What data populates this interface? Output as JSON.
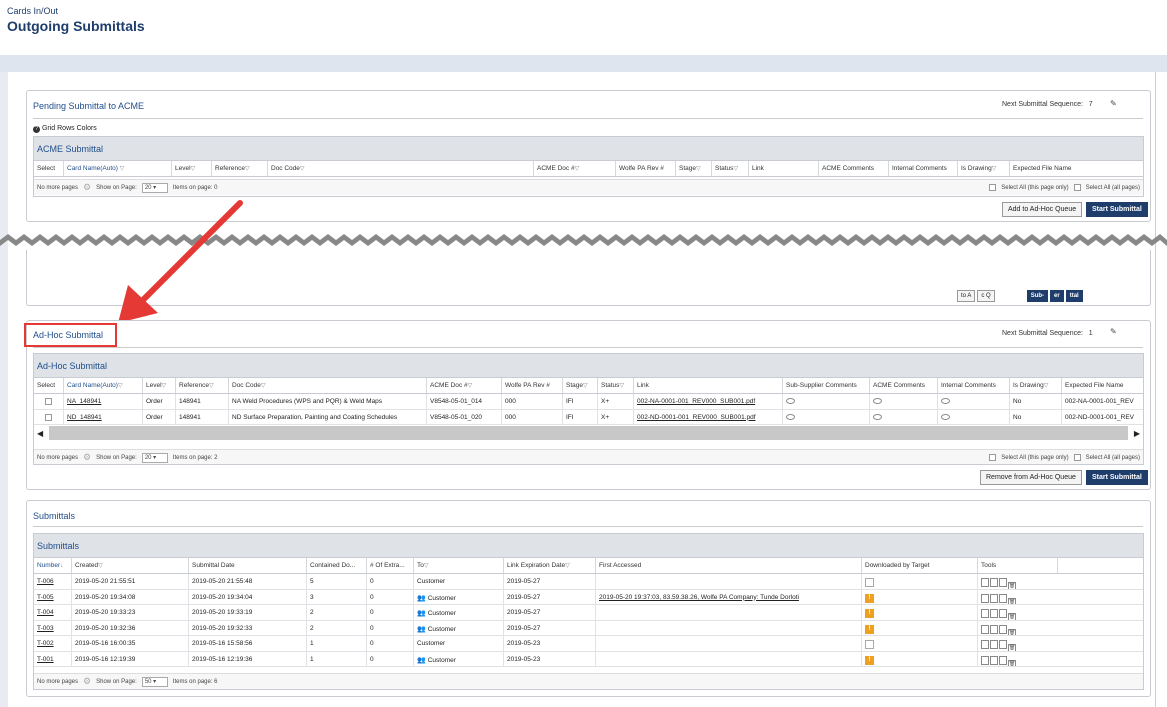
{
  "header": {
    "breadcrumb": "Cards In/Out",
    "title": "Outgoing Submittals"
  },
  "pending": {
    "title": "Pending Submittal to ACME",
    "next_seq_label": "Next Submittal Sequence:",
    "next_seq_value": "7",
    "grid_colors": "Grid Rows Colors",
    "grid_title": "ACME Submittal",
    "columns": [
      "Select",
      "Card Name(Auto)",
      "Level",
      "Reference",
      "Doc Code",
      "ACME Doc #",
      "Wolfe PA Rev #",
      "Stage",
      "Status",
      "Link",
      "ACME Comments",
      "Internal Comments",
      "Is Drawing",
      "Expected File Name"
    ],
    "pager": {
      "no_more": "No more pages",
      "show_on_page": "Show on Page:",
      "page_size": "20",
      "items_label": "Items on page: 0",
      "select_all_page": "Select All (this page only)",
      "select_all_pages": "Select All (all pages)"
    },
    "btn_add": "Add to Ad-Hoc Queue",
    "btn_start": "Start Submittal"
  },
  "partial_buttons": {
    "a": "to A",
    "b": "c Q",
    "c": "Sub-",
    "d": "er",
    "e": "ttal"
  },
  "adhoc": {
    "title": "Ad-Hoc Submittal",
    "next_seq_label": "Next Submittal Sequence:",
    "next_seq_value": "1",
    "grid_title": "Ad-Hoc Submittal",
    "columns": [
      "Select",
      "Card Name(Auto)",
      "Level",
      "Reference",
      "Doc Code",
      "ACME Doc #",
      "Wolfe PA Rev #",
      "Stage",
      "Status",
      "Link",
      "Sub-Supplier Comments",
      "ACME Comments",
      "Internal Comments",
      "Is Drawing",
      "Expected File Name"
    ],
    "rows": [
      {
        "card": "NA_148941",
        "level": "Order",
        "ref": "148941",
        "doc_code": "NA Weld Procedures (WPS and PQR) & Weld Maps",
        "acme_doc": "V8548-05-01_014",
        "rev": "000",
        "stage": "IFI",
        "status": "X+",
        "link": "002-NA-0001-001_REV000_SUB001.pdf",
        "is_drawing": "No",
        "expected": "002-NA-0001-001_REV"
      },
      {
        "card": "ND_148941",
        "level": "Order",
        "ref": "148941",
        "doc_code": "ND Surface Preparation, Painting and Coating Schedules",
        "acme_doc": "V8548-05-01_020",
        "rev": "000",
        "stage": "IFI",
        "status": "X+",
        "link": "002-ND-0001-001_REV000_SUB001.pdf",
        "is_drawing": "No",
        "expected": "002-ND-0001-001_REV"
      }
    ],
    "pager": {
      "no_more": "No more pages",
      "show_on_page": "Show on Page:",
      "page_size": "20",
      "items_label": "Items on page: 2",
      "select_all_page": "Select All (this page only)",
      "select_all_pages": "Select All (all pages)"
    },
    "btn_remove": "Remove from Ad-Hoc Queue",
    "btn_start": "Start Submittal"
  },
  "submittals": {
    "title": "Submittals",
    "grid_title": "Submittals",
    "columns": [
      "Number",
      "Created",
      "Submittal Date",
      "Contained Do...",
      "# Of Extra...",
      "To",
      "Link Expiration Date",
      "First Accessed",
      "Downloaded by Target",
      "Tools"
    ],
    "rows": [
      {
        "num": "T-006",
        "created": "2019-05-20 21:55:51",
        "date": "2019-05-20 21:55:48",
        "contained": "5",
        "extra": "0",
        "to": "Customer",
        "group": false,
        "expires": "2019-05-27",
        "accessed": "",
        "downloaded": false
      },
      {
        "num": "T-005",
        "created": "2019-05-20 19:34:08",
        "date": "2019-05-20 19:34:04",
        "contained": "3",
        "extra": "0",
        "to": "Customer",
        "group": true,
        "expires": "2019-05-27",
        "accessed": "2019-05-20 19:37:03, 83.59.38.26, Wolfe PA Company: Tunde Dorloti",
        "downloaded": true
      },
      {
        "num": "T-004",
        "created": "2019-05-20 19:33:23",
        "date": "2019-05-20 19:33:19",
        "contained": "2",
        "extra": "0",
        "to": "Customer",
        "group": true,
        "expires": "2019-05-27",
        "accessed": "",
        "downloaded": true
      },
      {
        "num": "T-003",
        "created": "2019-05-20 19:32:36",
        "date": "2019-05-20 19:32:33",
        "contained": "2",
        "extra": "0",
        "to": "Customer",
        "group": true,
        "expires": "2019-05-27",
        "accessed": "",
        "downloaded": true
      },
      {
        "num": "T-002",
        "created": "2019-05-16 16:00:35",
        "date": "2019-05-16 15:58:56",
        "contained": "1",
        "extra": "0",
        "to": "Customer",
        "group": false,
        "expires": "2019-05-23",
        "accessed": "",
        "downloaded": false
      },
      {
        "num": "T-001",
        "created": "2019-05-16 12:19:39",
        "date": "2019-05-16 12:19:36",
        "contained": "1",
        "extra": "0",
        "to": "Customer",
        "group": true,
        "expires": "2019-05-23",
        "accessed": "",
        "downloaded": true
      }
    ],
    "pager": {
      "no_more": "No more pages",
      "show_on_page": "Show on Page:",
      "page_size": "50",
      "items_label": "Items on page: 6"
    }
  },
  "colors": {
    "accent": "#1f3d6b",
    "link_blue": "#1f4e8c",
    "annotation_red": "#e53935",
    "warning": "#f0a020"
  }
}
